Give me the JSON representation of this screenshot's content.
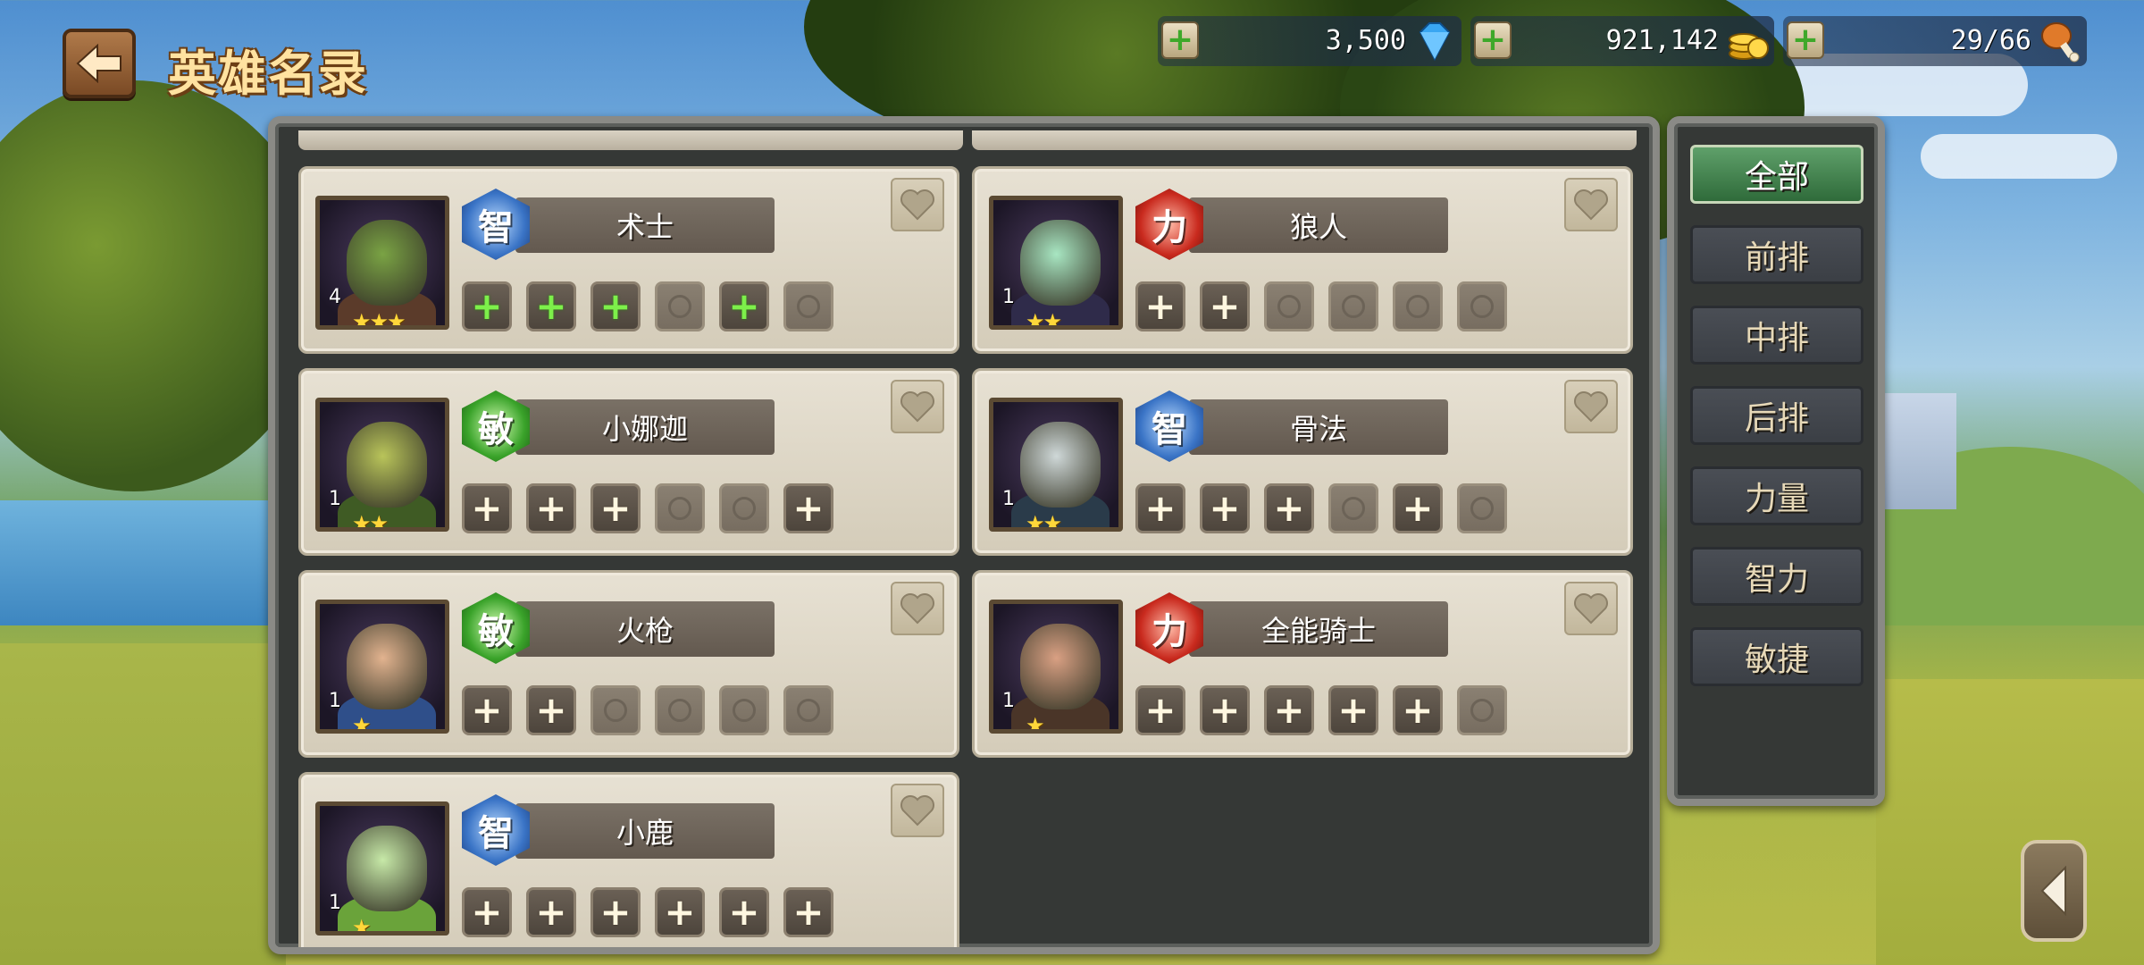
{
  "header": {
    "title": "英雄名录",
    "back_icon": "arrow-left-icon"
  },
  "resources": [
    {
      "name": "gems",
      "value": "3,500",
      "icon": "diamond-icon"
    },
    {
      "name": "gold",
      "value": "921,142",
      "icon": "gold-coins-icon"
    },
    {
      "name": "stamina",
      "value": "29/66",
      "icon": "drumstick-icon"
    }
  ],
  "heroes": [
    {
      "name": "术士",
      "class": "智",
      "class_type": "int",
      "level": "4",
      "stars": 3,
      "slots": [
        "green",
        "green",
        "green",
        "empty",
        "green",
        "empty"
      ]
    },
    {
      "name": "狼人",
      "class": "力",
      "class_type": "str",
      "level": "1",
      "stars": 2,
      "slots": [
        "white",
        "white",
        "empty",
        "empty",
        "empty",
        "empty"
      ]
    },
    {
      "name": "小娜迦",
      "class": "敏",
      "class_type": "agi",
      "level": "1",
      "stars": 2,
      "slots": [
        "white",
        "white",
        "white",
        "empty",
        "empty",
        "white"
      ]
    },
    {
      "name": "骨法",
      "class": "智",
      "class_type": "int",
      "level": "1",
      "stars": 2,
      "slots": [
        "white",
        "white",
        "white",
        "empty",
        "white",
        "empty"
      ]
    },
    {
      "name": "火枪",
      "class": "敏",
      "class_type": "agi",
      "level": "1",
      "stars": 1,
      "slots": [
        "white",
        "white",
        "empty",
        "empty",
        "empty",
        "empty"
      ]
    },
    {
      "name": "全能骑士",
      "class": "力",
      "class_type": "str",
      "level": "1",
      "stars": 1,
      "slots": [
        "white",
        "white",
        "white",
        "white",
        "white",
        "empty"
      ]
    },
    {
      "name": "小鹿",
      "class": "智",
      "class_type": "int",
      "level": "1",
      "stars": 1,
      "slots": [
        "white",
        "white",
        "white",
        "white",
        "white",
        "white"
      ]
    }
  ],
  "filters": [
    {
      "label": "全部",
      "active": true
    },
    {
      "label": "前排",
      "active": false
    },
    {
      "label": "中排",
      "active": false
    },
    {
      "label": "后排",
      "active": false
    },
    {
      "label": "力量",
      "active": false
    },
    {
      "label": "智力",
      "active": false
    },
    {
      "label": "敏捷",
      "active": false
    }
  ],
  "colors": {
    "int_badge": "#3a74c6",
    "agi_badge": "#3aa32a",
    "str_badge": "#c92a1e",
    "active_filter": "#3f8a4c",
    "title_text": "#ffe2a0"
  }
}
